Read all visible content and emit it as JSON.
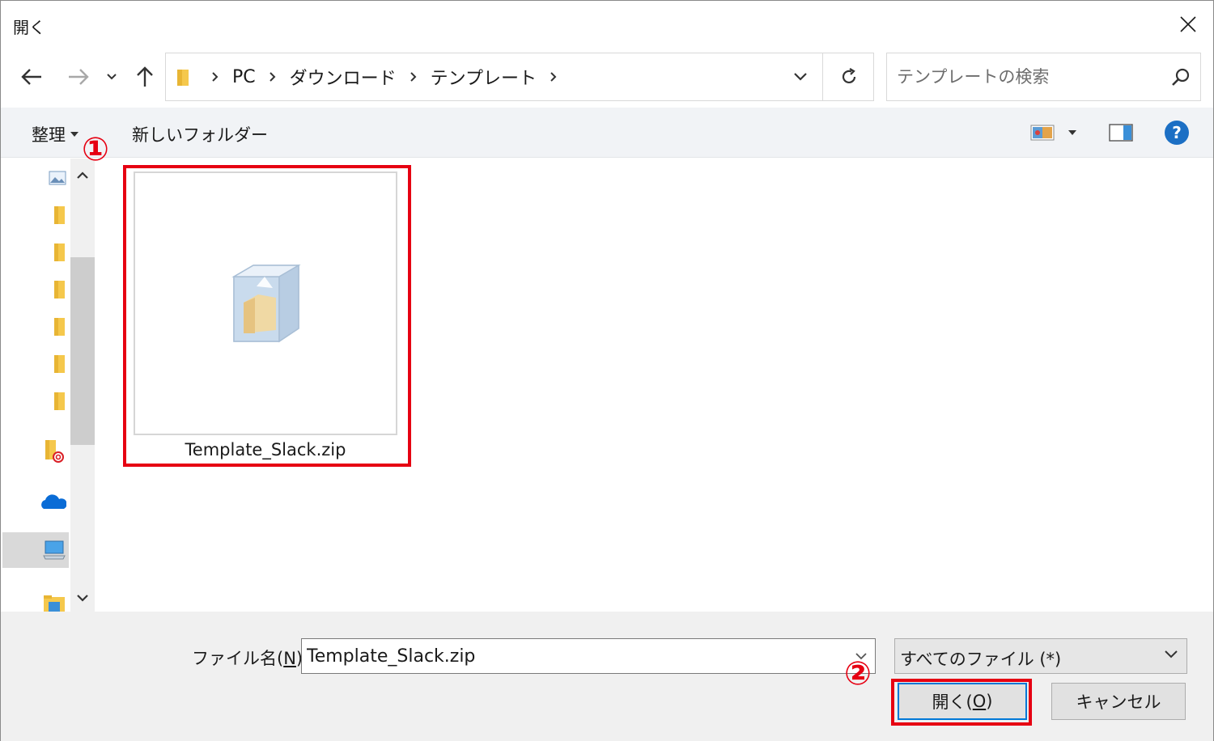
{
  "window": {
    "title": "開く"
  },
  "nav": {
    "back_icon": "arrow-left-icon",
    "forward_icon": "arrow-right-icon",
    "recent_icon": "chevron-down-icon",
    "up_icon": "arrow-up-icon"
  },
  "address": {
    "crumbs": [
      "PC",
      "ダウンロード",
      "テンプレート"
    ]
  },
  "search": {
    "placeholder": "テンプレートの検索"
  },
  "toolbar": {
    "organize_label": "整理",
    "new_folder_label": "新しいフォルダー"
  },
  "files": [
    {
      "name": "Template_Slack.zip",
      "icon": "zip-archive-icon"
    }
  ],
  "annotations": {
    "step1": "①",
    "step2": "②",
    "color": "#e60012"
  },
  "bottom": {
    "filename_label_pre": "ファイル名(",
    "filename_label_key": "N",
    "filename_label_post": "):",
    "filename_value": "Template_Slack.zip",
    "filetype_value": "すべてのファイル (*)",
    "open_label_pre": "開く(",
    "open_label_key": "O",
    "open_label_post": ")",
    "cancel_label": "キャンセル"
  },
  "colors": {
    "accent": "#0078d7",
    "toolbar_bg": "#f1f3f6",
    "bottom_bg": "#f0f0f0"
  }
}
